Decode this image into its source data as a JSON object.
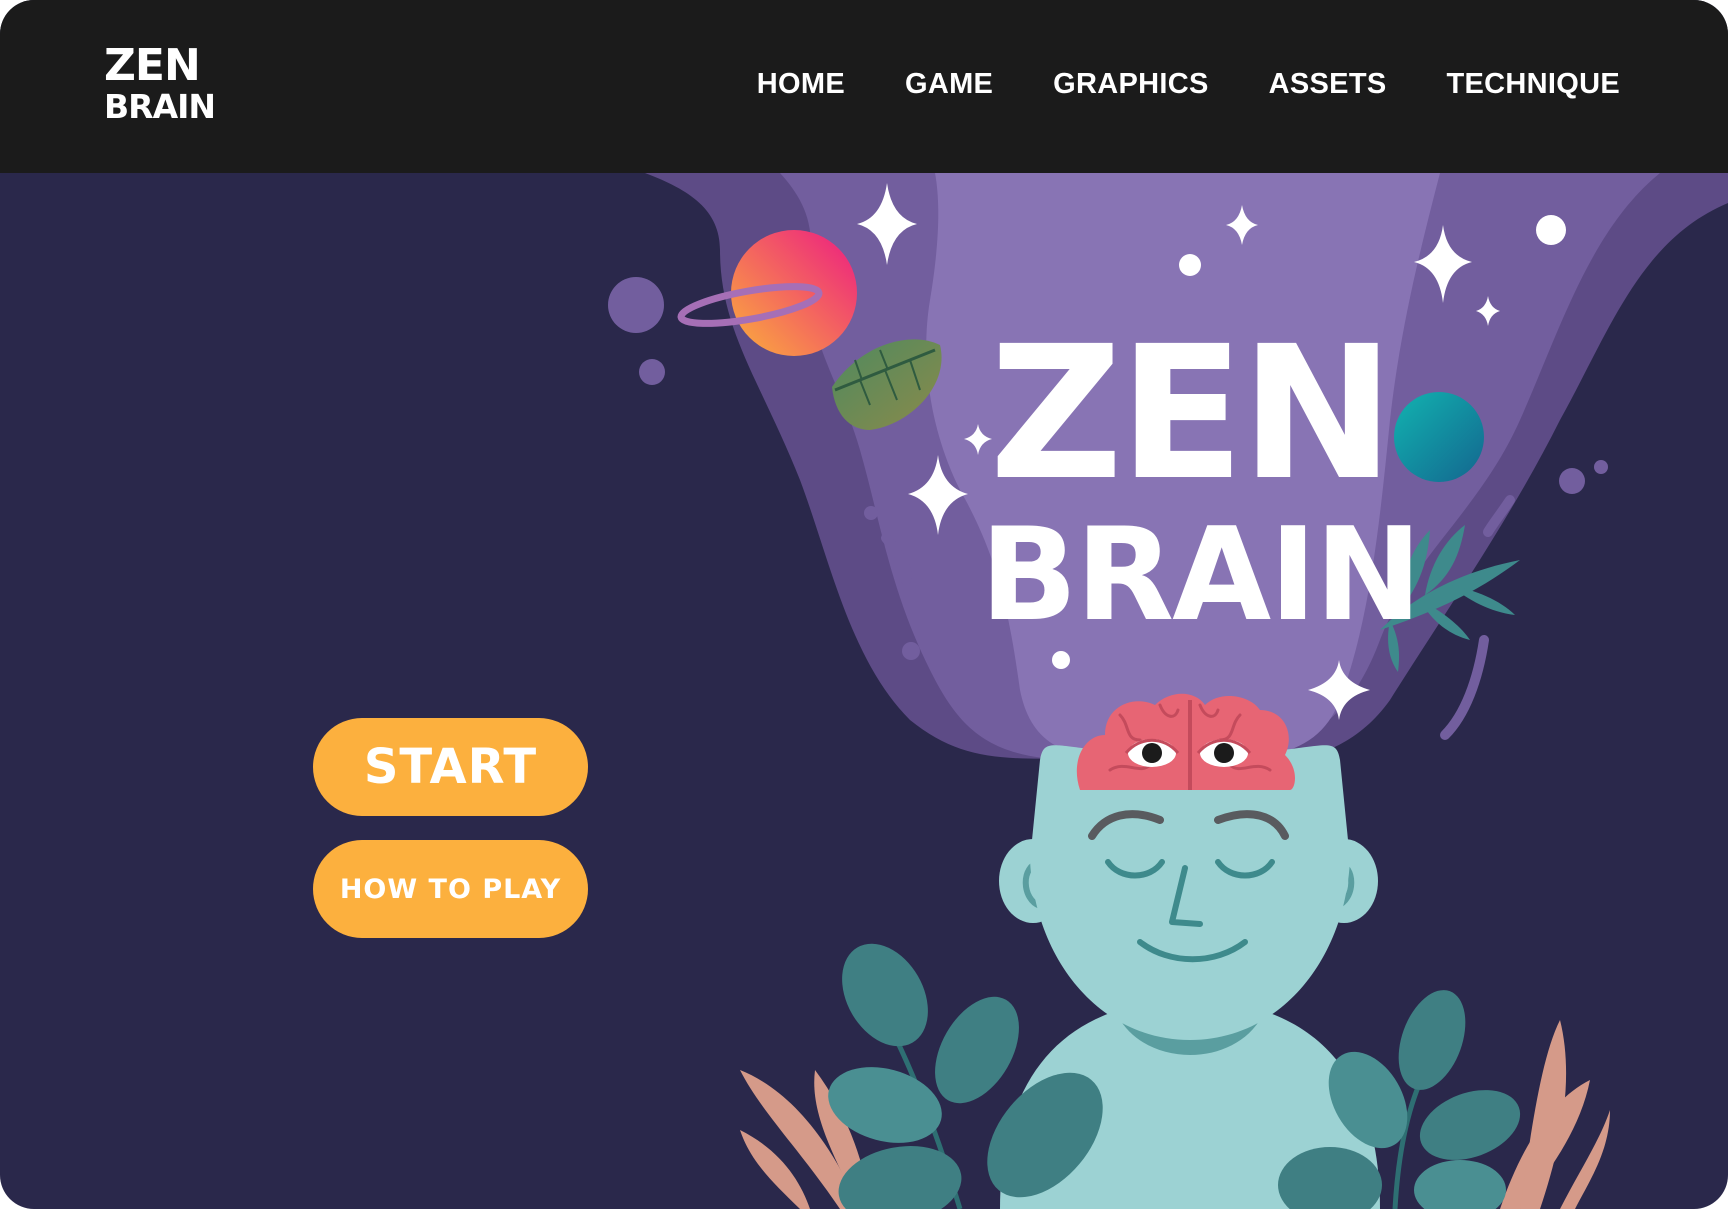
{
  "header": {
    "logo_line1": "ZEN",
    "logo_line2": "BRAIN",
    "nav": [
      {
        "label": "HOME"
      },
      {
        "label": "GAME"
      },
      {
        "label": "GRAPHICS"
      },
      {
        "label": "ASSETS"
      },
      {
        "label": "TECHNIQUE"
      }
    ]
  },
  "hero": {
    "title_line1": "ZEN",
    "title_line2": "BRAIN",
    "illustration": {
      "character": "meditating-head-with-open-brain",
      "brain_eyes": 2,
      "decorations": [
        "planet-ringed",
        "planet-teal",
        "leaf",
        "fern",
        "sparkle-stars",
        "plants"
      ]
    }
  },
  "actions": {
    "start_label": "START",
    "how_to_play_label": "HOW TO PLAY"
  },
  "colors": {
    "page_background": "#2a284b",
    "header_background": "#1b1b1b",
    "button": "#fcb03e",
    "smoke_light": "#8874b4",
    "smoke_mid": "#725e9e",
    "smoke_dark": "#5d4b86",
    "head": "#9cd2d3",
    "brain": "#e76574"
  }
}
